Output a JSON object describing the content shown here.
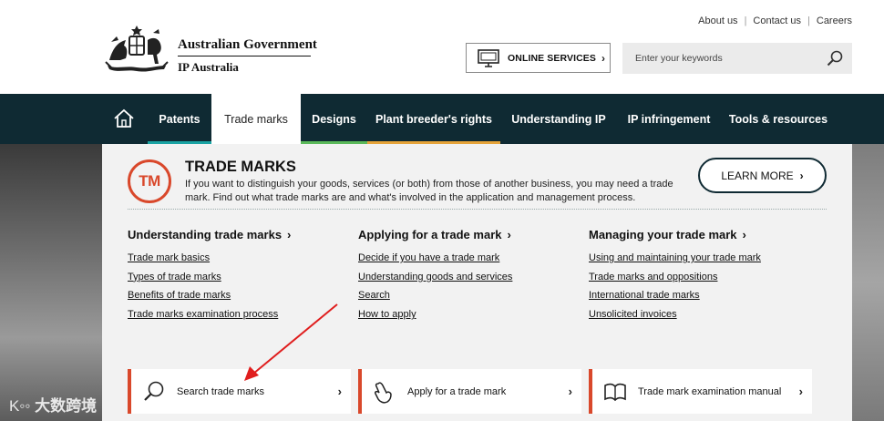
{
  "top_links": [
    "About us",
    "Contact us",
    "Careers"
  ],
  "logo": {
    "line1": "Australian Government",
    "line2": "IP Australia"
  },
  "online_services": {
    "label": "ONLINE SERVICES",
    "icon": "monitor-icon"
  },
  "search": {
    "placeholder": "Enter your keywords",
    "icon": "search-icon"
  },
  "nav": {
    "home_icon": "home-icon",
    "items": [
      {
        "label": "Patents",
        "active": false,
        "accent": "#1aa3a3"
      },
      {
        "label": "Trade marks",
        "active": true,
        "accent": ""
      },
      {
        "label": "Designs",
        "active": false,
        "accent": "#5ab95a"
      },
      {
        "label": "Plant breeder's rights",
        "active": false,
        "accent": "#e6a43a"
      },
      {
        "label": "Understanding IP",
        "active": false,
        "accent": ""
      },
      {
        "label": "IP infringement",
        "active": false,
        "accent": ""
      },
      {
        "label": "Tools & resources",
        "active": false,
        "accent": ""
      }
    ]
  },
  "intro": {
    "badge": "TM",
    "title": "TRADE MARKS",
    "description": "If you want to distinguish your goods, services (or both) from those of another business, you may need a trade mark. Find out what trade marks are and what's involved in the application and management process.",
    "learn_more": "LEARN MORE"
  },
  "columns": [
    {
      "heading": "Understanding trade marks",
      "links": [
        "Trade mark basics",
        "Types of trade marks",
        "Benefits of trade marks",
        "Trade marks examination process"
      ]
    },
    {
      "heading": "Applying for a trade mark",
      "links": [
        "Decide if you have a trade mark",
        "Understanding goods and services",
        "Search",
        "How to apply"
      ]
    },
    {
      "heading": "Managing your trade mark",
      "links": [
        "Using and maintaining your trade mark",
        "Trade marks and oppositions",
        "International trade marks",
        "Unsolicited invoices"
      ]
    }
  ],
  "quick_links": [
    {
      "label": "Search trade marks",
      "icon": "magnifier-icon"
    },
    {
      "label": "Apply for a trade mark",
      "icon": "hand-pointer-icon"
    },
    {
      "label": "Trade mark examination manual",
      "icon": "open-book-icon"
    }
  ],
  "colors": {
    "accent_red": "#d9482b",
    "nav_bg": "#0f2a33"
  },
  "watermark": "大数跨境"
}
